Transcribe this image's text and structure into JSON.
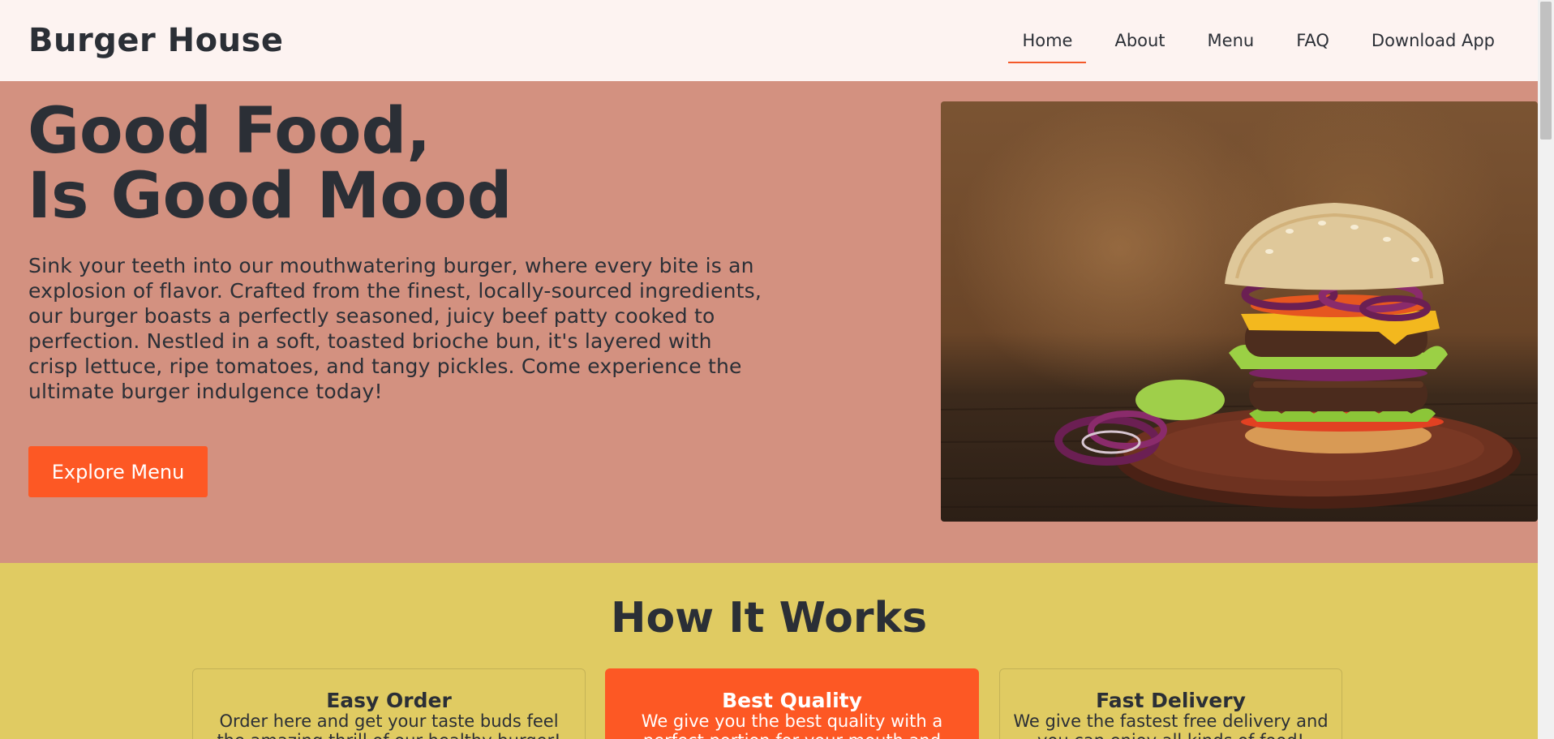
{
  "brand": "Burger House",
  "nav": {
    "items": [
      {
        "label": "Home",
        "active": true
      },
      {
        "label": "About",
        "active": false
      },
      {
        "label": "Menu",
        "active": false
      },
      {
        "label": "FAQ",
        "active": false
      },
      {
        "label": "Download App",
        "active": false
      }
    ]
  },
  "hero": {
    "title_line1": "Good Food,",
    "title_line2": "Is Good Mood",
    "description": "Sink your teeth into our mouthwatering burger, where every bite is an explosion of flavor. Crafted from the finest, locally-sourced ingredients, our burger boasts a perfectly seasoned, juicy beef patty cooked to perfection. Nestled in a soft, toasted brioche bun, it's layered with crisp lettuce, ripe tomatoes, and tangy pickles. Come experience the ultimate burger indulgence today!",
    "cta_label": "Explore Menu",
    "image_icon": "burger-photo"
  },
  "how": {
    "title": "How It Works",
    "cards": [
      {
        "title": "Easy Order",
        "text": "Order here and get your taste buds feel the amazing thrill of our healthy burger!"
      },
      {
        "title": "Best Quality",
        "text": "We give you the best quality with a perfect portion for your mouth and stomach!"
      },
      {
        "title": "Fast Delivery",
        "text": "We give the fastest free delivery and you can enjoy all kinds of food!"
      }
    ]
  },
  "colors": {
    "accent": "#fd5824",
    "hero_bg": "#d39180",
    "how_bg": "#e0cb62",
    "nav_bg": "#fdf3f1",
    "text": "#2b2f36"
  }
}
